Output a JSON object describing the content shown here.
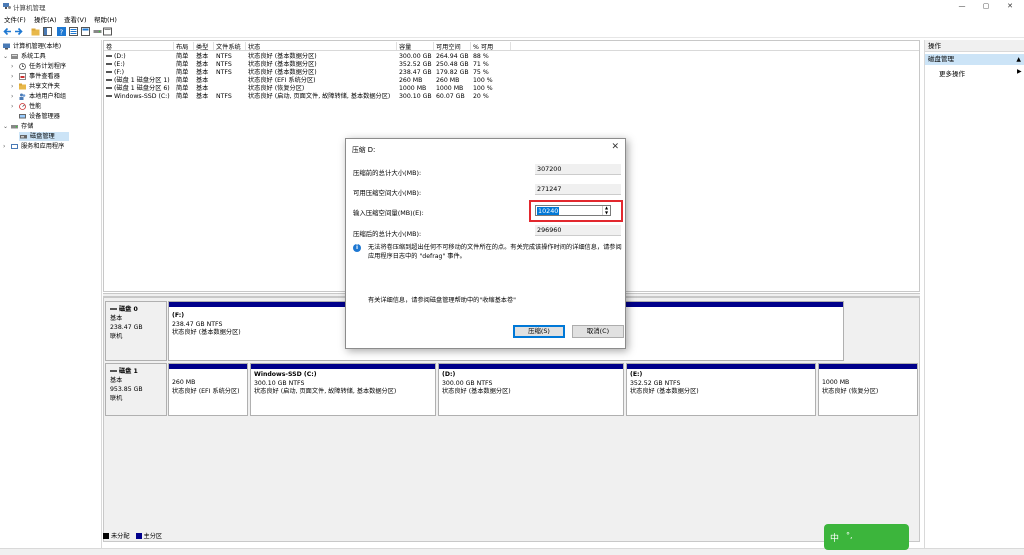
{
  "window": {
    "title": "计算机管理",
    "minimize": "—",
    "maximize": "▢",
    "close": "✕"
  },
  "menu": [
    "文件(F)",
    "操作(A)",
    "查看(V)",
    "帮助(H)"
  ],
  "tree": {
    "root": "计算机管理(本地)",
    "system_tools": "系统工具",
    "task_scheduler": "任务计划程序",
    "event_viewer": "事件查看器",
    "shared_folders": "共享文件夹",
    "local_users": "本地用户和组",
    "performance": "性能",
    "device_manager": "设备管理器",
    "storage": "存储",
    "disk_management": "磁盘管理",
    "services": "服务和应用程序"
  },
  "volume_table": {
    "headers": [
      "卷",
      "布局",
      "类型",
      "文件系统",
      "状态",
      "容量",
      "可用空间",
      "% 可用"
    ],
    "rows": [
      [
        "(D:)",
        "简单",
        "基本",
        "NTFS",
        "状态良好 (基本数据分区)",
        "300.00 GB",
        "264.94 GB",
        "88 %"
      ],
      [
        "(E:)",
        "简单",
        "基本",
        "NTFS",
        "状态良好 (基本数据分区)",
        "352.52 GB",
        "250.48 GB",
        "71 %"
      ],
      [
        "(F:)",
        "简单",
        "基本",
        "NTFS",
        "状态良好 (基本数据分区)",
        "238.47 GB",
        "179.82 GB",
        "75 %"
      ],
      [
        "(磁盘 1 磁盘分区 1)",
        "简单",
        "基本",
        "",
        "状态良好 (EFI 系统分区)",
        "260 MB",
        "260 MB",
        "100 %"
      ],
      [
        "(磁盘 1 磁盘分区 6)",
        "简单",
        "基本",
        "",
        "状态良好 (恢复分区)",
        "1000 MB",
        "1000 MB",
        "100 %"
      ],
      [
        "Windows-SSD (C:)",
        "简单",
        "基本",
        "NTFS",
        "状态良好 (启动, 页面文件, 故障转储, 基本数据分区)",
        "300.10 GB",
        "60.07 GB",
        "20 %"
      ]
    ]
  },
  "disk0": {
    "name": "磁盘 0",
    "type": "基本",
    "size": "238.47 GB",
    "status": "联机",
    "part": {
      "name": "(F:)",
      "size": "238.47 GB NTFS",
      "status": "状态良好 (基本数据分区)"
    }
  },
  "disk1": {
    "name": "磁盘 1",
    "type": "基本",
    "size": "953.85 GB",
    "status": "联机",
    "parts": [
      {
        "name": "",
        "size": "260 MB",
        "status": "状态良好 (EFI 系统分区)"
      },
      {
        "name": "Windows-SSD  (C:)",
        "size": "300.10 GB NTFS",
        "status": "状态良好 (启动, 页面文件, 故障转储, 基本数据分区)"
      },
      {
        "name": "(D:)",
        "size": "300.00 GB NTFS",
        "status": "状态良好 (基本数据分区)"
      },
      {
        "name": "(E:)",
        "size": "352.52 GB NTFS",
        "status": "状态良好 (基本数据分区)"
      },
      {
        "name": "",
        "size": "1000 MB",
        "status": "状态良好 (恢复分区)"
      }
    ]
  },
  "legend": {
    "unallocated": "未分配",
    "primary": "主分区",
    "unallocated_color": "#000000",
    "primary_color": "#00008b"
  },
  "actions": {
    "header": "操作",
    "section": "磁盘管理",
    "more": "更多操作"
  },
  "dialog": {
    "title": "压缩 D:",
    "total_before_label": "压缩前的总计大小(MB):",
    "total_before": "307200",
    "available_label": "可用压缩空间大小(MB):",
    "available": "271247",
    "input_label": "输入压缩空间量(MB)(E):",
    "input_value": "10240",
    "total_after_label": "压缩后的总计大小(MB):",
    "total_after": "296960",
    "info": "无法将卷压缩到超出任何不可移动的文件所在的点。有关完成该操作时间的详细信息，请参阅应用程序日志中的 \"defrag\" 事件。",
    "help": "有关详细信息，请参阅磁盘管理帮助中的\"收缩基本卷\"",
    "ok": "压缩(S)",
    "cancel": "取消(C)"
  },
  "ime": {
    "mode": "中"
  },
  "colors": {
    "partition_bar": "#00008b",
    "selection": "#cce4f7",
    "highlight_box": "#e2282e",
    "ime_bg": "#3cb53c"
  }
}
